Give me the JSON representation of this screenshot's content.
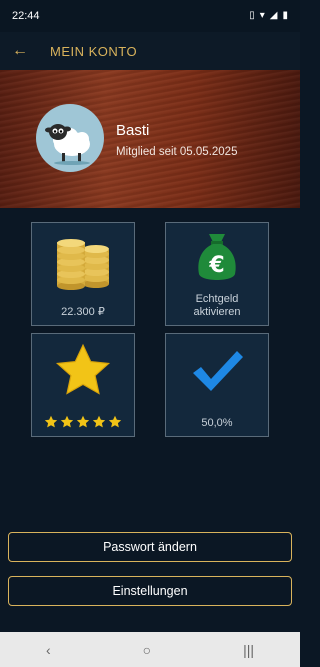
{
  "status_bar": {
    "time": "22:44",
    "icons": [
      "vibrate-icon",
      "wifi-icon",
      "signal-icon",
      "battery-icon"
    ]
  },
  "header": {
    "back_icon": "arrow-left-icon",
    "title": "MEIN KONTO"
  },
  "profile": {
    "name": "Basti",
    "member_since": "Mitglied seit 05.05.2025",
    "avatar_icon": "sheep-avatar"
  },
  "tiles": [
    {
      "id": "coins",
      "icon": "coin-stack-icon",
      "label": "22.300 ₽"
    },
    {
      "id": "real-money",
      "icon": "money-bag-euro-icon",
      "label_line1": "Echtgeld",
      "label_line2": "aktivieren"
    },
    {
      "id": "rating",
      "icon": "star-icon",
      "rating": 5,
      "max_rating": 5
    },
    {
      "id": "percentage",
      "icon": "checkmark-icon",
      "label": "50,0%"
    }
  ],
  "buttons": {
    "change_password": "Passwort ändern",
    "settings": "Einstellungen"
  },
  "nav_bar": {
    "back": "‹",
    "home": "○",
    "recents": "|||"
  },
  "colors": {
    "accent": "#d9b35c",
    "background": "#0b1724",
    "tile": "#13283c"
  }
}
